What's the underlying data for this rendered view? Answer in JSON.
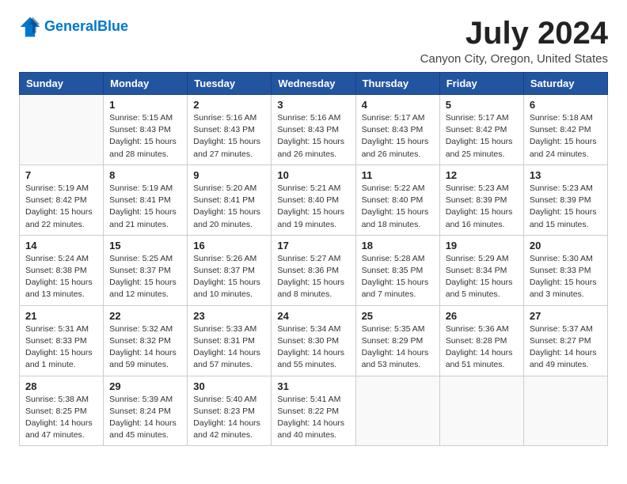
{
  "header": {
    "logo_line1": "General",
    "logo_line2": "Blue",
    "title": "July 2024",
    "subtitle": "Canyon City, Oregon, United States"
  },
  "columns": [
    "Sunday",
    "Monday",
    "Tuesday",
    "Wednesday",
    "Thursday",
    "Friday",
    "Saturday"
  ],
  "weeks": [
    [
      {
        "day": "",
        "info": ""
      },
      {
        "day": "1",
        "info": "Sunrise: 5:15 AM\nSunset: 8:43 PM\nDaylight: 15 hours\nand 28 minutes."
      },
      {
        "day": "2",
        "info": "Sunrise: 5:16 AM\nSunset: 8:43 PM\nDaylight: 15 hours\nand 27 minutes."
      },
      {
        "day": "3",
        "info": "Sunrise: 5:16 AM\nSunset: 8:43 PM\nDaylight: 15 hours\nand 26 minutes."
      },
      {
        "day": "4",
        "info": "Sunrise: 5:17 AM\nSunset: 8:43 PM\nDaylight: 15 hours\nand 26 minutes."
      },
      {
        "day": "5",
        "info": "Sunrise: 5:17 AM\nSunset: 8:42 PM\nDaylight: 15 hours\nand 25 minutes."
      },
      {
        "day": "6",
        "info": "Sunrise: 5:18 AM\nSunset: 8:42 PM\nDaylight: 15 hours\nand 24 minutes."
      }
    ],
    [
      {
        "day": "7",
        "info": "Sunrise: 5:19 AM\nSunset: 8:42 PM\nDaylight: 15 hours\nand 22 minutes."
      },
      {
        "day": "8",
        "info": "Sunrise: 5:19 AM\nSunset: 8:41 PM\nDaylight: 15 hours\nand 21 minutes."
      },
      {
        "day": "9",
        "info": "Sunrise: 5:20 AM\nSunset: 8:41 PM\nDaylight: 15 hours\nand 20 minutes."
      },
      {
        "day": "10",
        "info": "Sunrise: 5:21 AM\nSunset: 8:40 PM\nDaylight: 15 hours\nand 19 minutes."
      },
      {
        "day": "11",
        "info": "Sunrise: 5:22 AM\nSunset: 8:40 PM\nDaylight: 15 hours\nand 18 minutes."
      },
      {
        "day": "12",
        "info": "Sunrise: 5:23 AM\nSunset: 8:39 PM\nDaylight: 15 hours\nand 16 minutes."
      },
      {
        "day": "13",
        "info": "Sunrise: 5:23 AM\nSunset: 8:39 PM\nDaylight: 15 hours\nand 15 minutes."
      }
    ],
    [
      {
        "day": "14",
        "info": "Sunrise: 5:24 AM\nSunset: 8:38 PM\nDaylight: 15 hours\nand 13 minutes."
      },
      {
        "day": "15",
        "info": "Sunrise: 5:25 AM\nSunset: 8:37 PM\nDaylight: 15 hours\nand 12 minutes."
      },
      {
        "day": "16",
        "info": "Sunrise: 5:26 AM\nSunset: 8:37 PM\nDaylight: 15 hours\nand 10 minutes."
      },
      {
        "day": "17",
        "info": "Sunrise: 5:27 AM\nSunset: 8:36 PM\nDaylight: 15 hours\nand 8 minutes."
      },
      {
        "day": "18",
        "info": "Sunrise: 5:28 AM\nSunset: 8:35 PM\nDaylight: 15 hours\nand 7 minutes."
      },
      {
        "day": "19",
        "info": "Sunrise: 5:29 AM\nSunset: 8:34 PM\nDaylight: 15 hours\nand 5 minutes."
      },
      {
        "day": "20",
        "info": "Sunrise: 5:30 AM\nSunset: 8:33 PM\nDaylight: 15 hours\nand 3 minutes."
      }
    ],
    [
      {
        "day": "21",
        "info": "Sunrise: 5:31 AM\nSunset: 8:33 PM\nDaylight: 15 hours\nand 1 minute."
      },
      {
        "day": "22",
        "info": "Sunrise: 5:32 AM\nSunset: 8:32 PM\nDaylight: 14 hours\nand 59 minutes."
      },
      {
        "day": "23",
        "info": "Sunrise: 5:33 AM\nSunset: 8:31 PM\nDaylight: 14 hours\nand 57 minutes."
      },
      {
        "day": "24",
        "info": "Sunrise: 5:34 AM\nSunset: 8:30 PM\nDaylight: 14 hours\nand 55 minutes."
      },
      {
        "day": "25",
        "info": "Sunrise: 5:35 AM\nSunset: 8:29 PM\nDaylight: 14 hours\nand 53 minutes."
      },
      {
        "day": "26",
        "info": "Sunrise: 5:36 AM\nSunset: 8:28 PM\nDaylight: 14 hours\nand 51 minutes."
      },
      {
        "day": "27",
        "info": "Sunrise: 5:37 AM\nSunset: 8:27 PM\nDaylight: 14 hours\nand 49 minutes."
      }
    ],
    [
      {
        "day": "28",
        "info": "Sunrise: 5:38 AM\nSunset: 8:25 PM\nDaylight: 14 hours\nand 47 minutes."
      },
      {
        "day": "29",
        "info": "Sunrise: 5:39 AM\nSunset: 8:24 PM\nDaylight: 14 hours\nand 45 minutes."
      },
      {
        "day": "30",
        "info": "Sunrise: 5:40 AM\nSunset: 8:23 PM\nDaylight: 14 hours\nand 42 minutes."
      },
      {
        "day": "31",
        "info": "Sunrise: 5:41 AM\nSunset: 8:22 PM\nDaylight: 14 hours\nand 40 minutes."
      },
      {
        "day": "",
        "info": ""
      },
      {
        "day": "",
        "info": ""
      },
      {
        "day": "",
        "info": ""
      }
    ]
  ]
}
